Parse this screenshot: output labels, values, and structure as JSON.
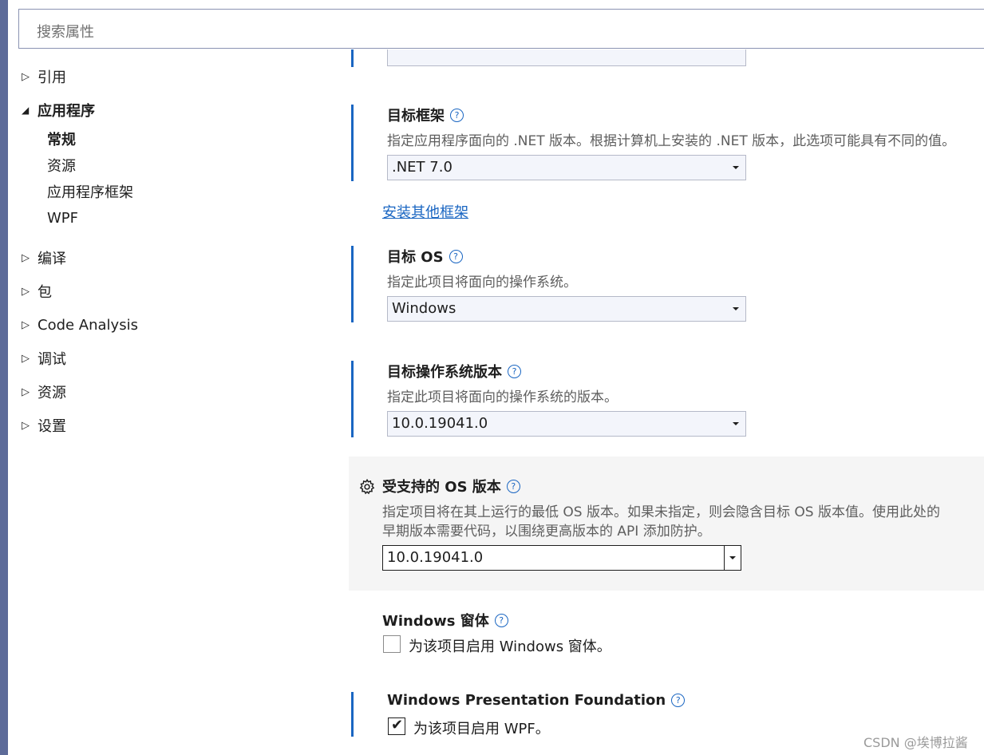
{
  "search": {
    "placeholder": "搜索属性"
  },
  "tree": {
    "references": "引用",
    "application": "应用程序",
    "app_children": [
      "常规",
      "资源",
      "应用程序框架",
      "WPF"
    ],
    "build": "编译",
    "package": "包",
    "code_analysis": "Code Analysis",
    "debug": "调试",
    "resources": "资源",
    "settings": "设置"
  },
  "target_framework": {
    "title": "目标框架",
    "description": "指定应用程序面向的 .NET 版本。根据计算机上安装的 .NET 版本，此选项可能具有不同的值。",
    "value": ".NET 7.0",
    "install_link": "安装其他框架"
  },
  "target_os": {
    "title": "目标 OS",
    "description": "指定此项目将面向的操作系统。",
    "value": "Windows"
  },
  "target_os_version": {
    "title": "目标操作系统版本",
    "description": "指定此项目将面向的操作系统的版本。",
    "value": "10.0.19041.0"
  },
  "supported_os_version": {
    "title": "受支持的 OS 版本",
    "description_line1": "指定项目将在其上运行的最低 OS 版本。如果未指定，则会隐含目标 OS 版本值。使用此处的",
    "description_line2": "早期版本需要代码，以围绕更高版本的 API 添加防护。",
    "value": "10.0.19041.0"
  },
  "windows_forms": {
    "title": "Windows 窗体",
    "checkbox_label": "为该项目启用 Windows 窗体。",
    "checked": false
  },
  "wpf": {
    "title": "Windows Presentation Foundation",
    "checkbox_label": "为该项目启用 WPF。",
    "checked": true
  },
  "watermark": "CSDN @埃博拉酱",
  "colors": {
    "accent": "#1a66c2",
    "sidebar_strip": "#5d6b99"
  }
}
